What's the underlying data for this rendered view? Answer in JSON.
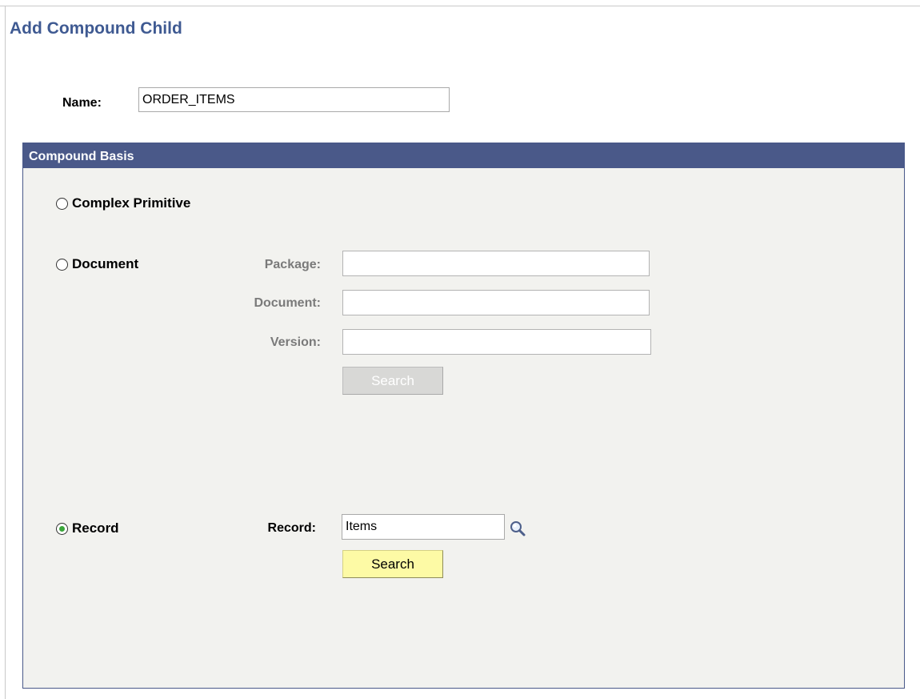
{
  "page": {
    "title": "Add Compound Child"
  },
  "name_field": {
    "label": "Name:",
    "value": "ORDER_ITEMS"
  },
  "compound_basis": {
    "header": "Compound Basis",
    "options": {
      "complex_primitive": {
        "label": "Complex Primitive",
        "selected": false
      },
      "document": {
        "label": "Document",
        "selected": false
      },
      "record": {
        "label": "Record",
        "selected": true
      }
    },
    "document_fields": {
      "package": {
        "label": "Package:",
        "value": ""
      },
      "document": {
        "label": "Document:",
        "value": ""
      },
      "version": {
        "label": "Version:",
        "value": ""
      },
      "search_label": "Search"
    },
    "record_fields": {
      "record": {
        "label": "Record:",
        "value": "Items"
      },
      "search_label": "Search"
    }
  },
  "icons": {
    "lookup": "magnifying-glass-icon"
  },
  "colors": {
    "title": "#3f5a92",
    "header_bg": "#4a5989",
    "panel_bg": "#f2f2ef",
    "primary_button": "#fdfaa5",
    "radio_selected": "#3aa63a"
  }
}
